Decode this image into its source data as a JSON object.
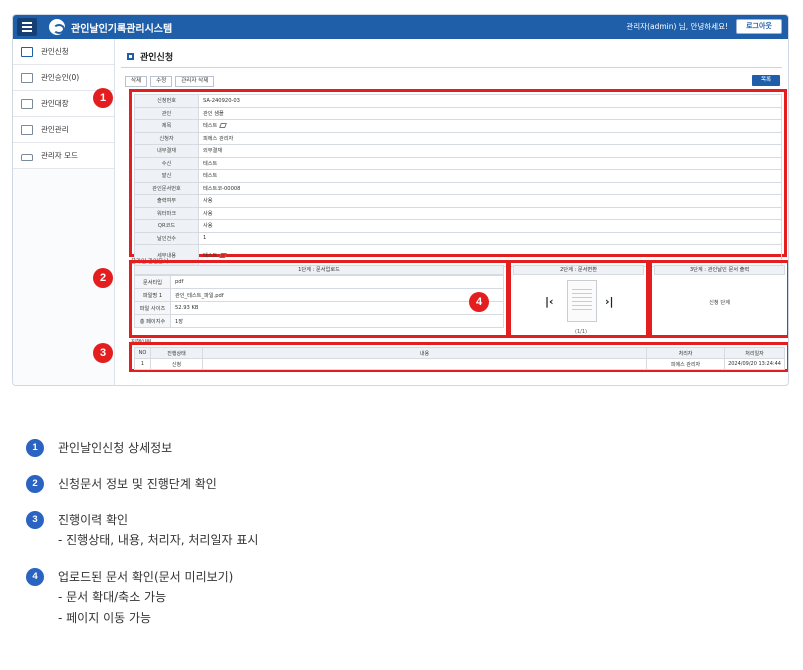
{
  "app": {
    "title": "관인날인기록관리시스템",
    "user": "관리자(admin) 님, 안녕하세요!",
    "logout": "로그아웃"
  },
  "sidebar": {
    "items": [
      {
        "label": "관인신청",
        "icon": "document-icon"
      },
      {
        "label": "관인승인(0)",
        "icon": "list-icon"
      },
      {
        "label": "관인대장",
        "icon": "ledger-icon"
      },
      {
        "label": "관인관리",
        "icon": "seal-icon"
      },
      {
        "label": "관리자 모드",
        "icon": "lock-icon"
      }
    ]
  },
  "page": {
    "title": "관인신청",
    "buttons": {
      "delete": "삭제",
      "edit": "수정",
      "admin_delete": "관리자 삭제",
      "list": "목록"
    }
  },
  "detail": {
    "rows": [
      {
        "key": "신청번호",
        "value": "SA-240920-03"
      },
      {
        "key": "관인",
        "value": "관인 샘플"
      },
      {
        "key": "제목",
        "value": "테스트"
      },
      {
        "key": "신청자",
        "value": "피에스 관리자"
      },
      {
        "key": "내부결재",
        "value": "외부결재"
      },
      {
        "key": "수신",
        "value": "테스트"
      },
      {
        "key": "발신",
        "value": "테스트"
      },
      {
        "key": "관인문서번호",
        "value": "테스트코-00008"
      },
      {
        "key": "출력여부",
        "value": "사용"
      },
      {
        "key": "워터마크",
        "value": "사용"
      },
      {
        "key": "QR코드",
        "value": "사용"
      },
      {
        "key": "날인건수",
        "value": "1"
      },
      {
        "key": "세부내용",
        "value": "테스트"
      }
    ]
  },
  "docs": {
    "section_label": "온라인 관인문서",
    "step1": {
      "header": "1단계 : 문서업로드",
      "rows": [
        {
          "key": "문서타입",
          "value": "pdf"
        },
        {
          "key": "파일명 1",
          "value": "관인_테스트_파일.pdf"
        },
        {
          "key": "파일 사이즈",
          "value": "52.93 KB"
        },
        {
          "key": "총 페이지수",
          "value": "1장"
        }
      ]
    },
    "step2": {
      "header": "2단계 : 문서변환",
      "page": "(1/1)"
    },
    "step3": {
      "header": "3단계 : 관인날인 문서 출력",
      "status": "신청 단계"
    }
  },
  "history": {
    "section_label": "진행이력",
    "columns": [
      "NO",
      "진행상태",
      "내용",
      "처리자",
      "처리일자"
    ],
    "rows": [
      {
        "no": "1",
        "status": "신청",
        "content": "",
        "handler": "피에스 관리자",
        "date": "2024/09/20 13:24:44"
      }
    ]
  },
  "badges": [
    "1",
    "2",
    "3",
    "4"
  ],
  "legend": {
    "items": [
      {
        "num": "1",
        "text": "관인날인신청 상세정보",
        "subs": []
      },
      {
        "num": "2",
        "text": "신청문서 정보 및 진행단계 확인",
        "subs": []
      },
      {
        "num": "3",
        "text": "진행이력 확인",
        "subs": [
          "- 진행상태, 내용, 처리자, 처리일자 표시"
        ]
      },
      {
        "num": "4",
        "text": "업로드된 문서 확인(문서 미리보기)",
        "subs": [
          "- 문서 확대/축소 가능",
          "- 페이지 이동 가능"
        ]
      }
    ]
  },
  "colors": {
    "header": "#1f5fa9",
    "highlight": "#e41e1e",
    "legend_badge": "#2a63c1"
  }
}
